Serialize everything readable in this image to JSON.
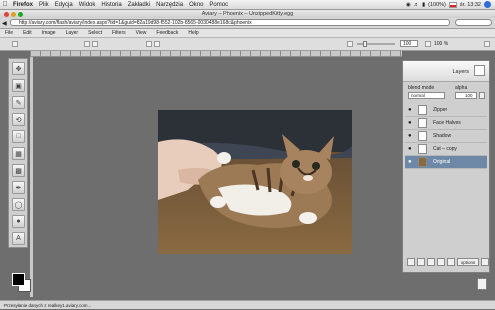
{
  "mac_menubar": {
    "items": [
      "Firefox",
      "Plik",
      "Edycja",
      "Widok",
      "Historia",
      "Zakładki",
      "Narzędzia",
      "Okno",
      "Pomoc"
    ],
    "clock": "śr. 13:32",
    "battery": "(100%)"
  },
  "window": {
    "title": "Aviary – Phoenix – UnzippedKitty.egg"
  },
  "addressbar": {
    "url": "http://aviary.com/flash/aviary/index.aspx?tid=1&guid=82a19d98-f552-102b-8565-0030488e168c&phoenix"
  },
  "app_menu": [
    "File",
    "Edit",
    "Image",
    "Layer",
    "Select",
    "Filters",
    "View",
    "Feedback",
    "Help"
  ],
  "toolbar": {
    "zoom_value": "100",
    "zoom_percent": "100 %"
  },
  "layers_panel": {
    "title": "Layers",
    "blend_mode_label": "blend mode",
    "blend_mode_value": "normal",
    "alpha_label": "alpha",
    "alpha_value": "100",
    "layers": [
      {
        "name": "Zipper"
      },
      {
        "name": "Face Halves"
      },
      {
        "name": "Shadow"
      },
      {
        "name": "Cat – copy"
      },
      {
        "name": "Original"
      }
    ],
    "options_label": "options"
  },
  "status": "Przesyłanie danych z realkey1.aviary.com..."
}
